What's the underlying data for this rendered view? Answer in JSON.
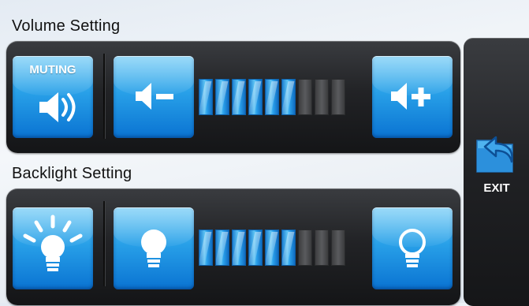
{
  "volume": {
    "title": "Volume Setting",
    "muting_label": "MUTING",
    "level": 6,
    "max_level": 9
  },
  "backlight": {
    "title": "Backlight Setting",
    "level": 6,
    "max_level": 9
  },
  "exit": {
    "label": "EXIT"
  },
  "icons": {
    "muting": "speaker-sound-icon",
    "volume_down": "volume-minus-icon",
    "volume_up": "volume-plus-icon",
    "backlight_auto": "bright-bulb-icon",
    "backlight_down": "bulb-filled-icon",
    "backlight_up": "bulb-outline-icon",
    "exit": "folder-back-arrow-icon"
  },
  "colors": {
    "button_blue": "#28a0e8",
    "segment_on": "#3bb0ee",
    "segment_off": "#4a4b4e",
    "panel_dark": "#202124"
  }
}
